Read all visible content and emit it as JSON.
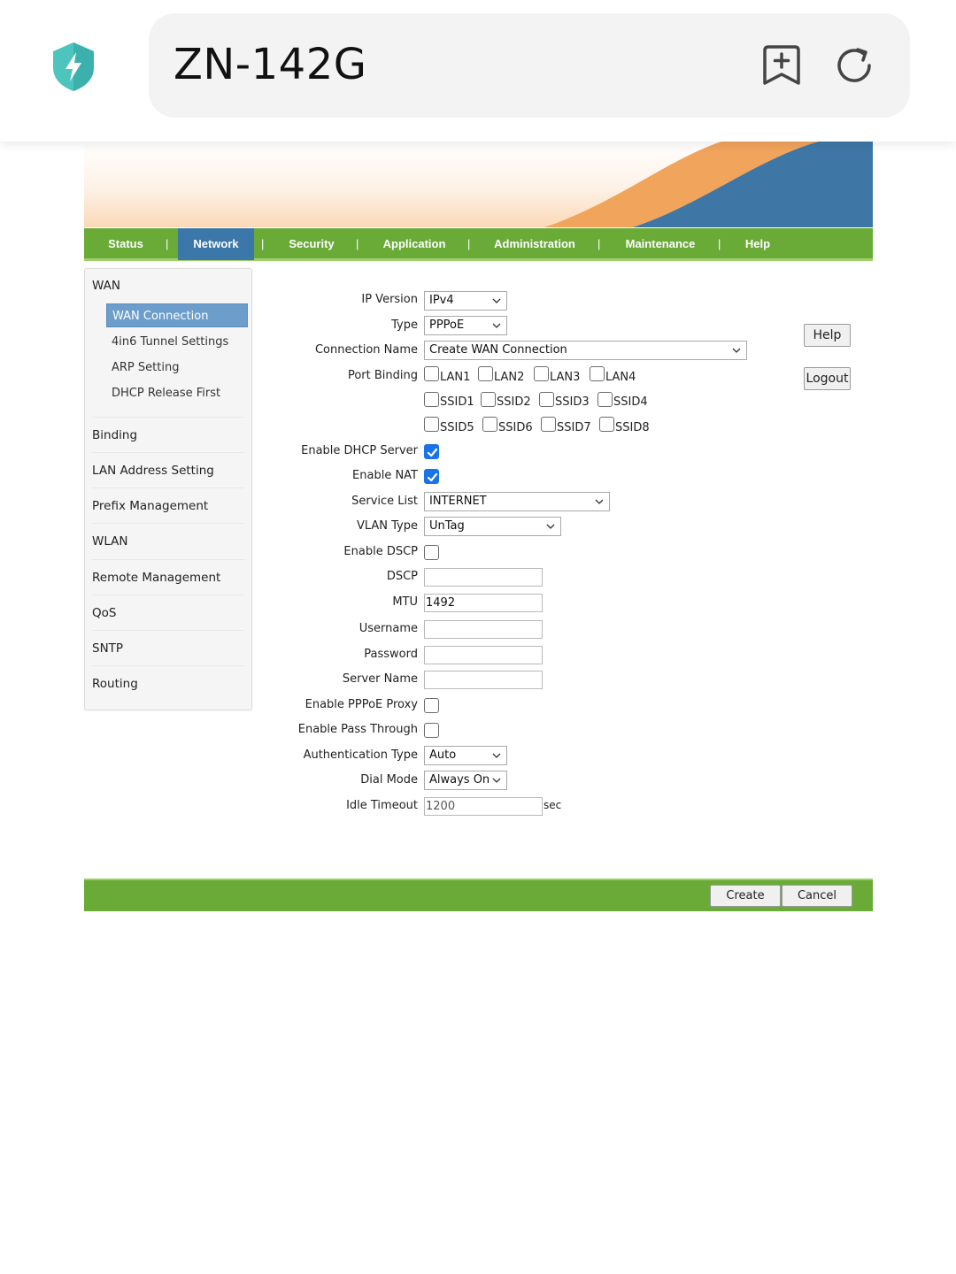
{
  "browser": {
    "url_title": "ZN-142G",
    "shield_icon": "shield-bolt-icon",
    "bookmark_icon": "bookmark-add-icon",
    "reload_icon": "reload-icon"
  },
  "colors": {
    "nav_green": "#6aaa37",
    "nav_active_blue": "#3b77a9",
    "banner_orange": "#f0a45c",
    "banner_blue": "#3e77a6",
    "sidebar_active": "#6d9ecb",
    "checkbox_checked": "#1a73e8"
  },
  "nav": {
    "items": [
      "Status",
      "Network",
      "Security",
      "Application",
      "Administration",
      "Maintenance",
      "Help"
    ],
    "active": "Network",
    "separator": "|"
  },
  "sidebar": {
    "wan": "WAN",
    "wan_items": [
      "WAN Connection",
      "4in6 Tunnel Settings",
      "ARP Setting",
      "DHCP Release First"
    ],
    "active_item": "WAN Connection",
    "sections": [
      "Binding",
      "LAN Address Setting",
      "Prefix Management",
      "WLAN",
      "Remote Management",
      "QoS",
      "SNTP",
      "Routing"
    ]
  },
  "form": {
    "ip_version": {
      "label": "IP Version",
      "value": "IPv4"
    },
    "type": {
      "label": "Type",
      "value": "PPPoE"
    },
    "connection_name": {
      "label": "Connection Name",
      "value": "Create WAN Connection"
    },
    "port_binding": {
      "label": "Port Binding",
      "ports": [
        "LAN1",
        "LAN2",
        "LAN3",
        "LAN4",
        "SSID1",
        "SSID2",
        "SSID3",
        "SSID4",
        "SSID5",
        "SSID6",
        "SSID7",
        "SSID8"
      ],
      "checked": []
    },
    "enable_dhcp_server": {
      "label": "Enable DHCP Server",
      "checked": true
    },
    "enable_nat": {
      "label": "Enable NAT",
      "checked": true
    },
    "service_list": {
      "label": "Service List",
      "value": "INTERNET"
    },
    "vlan_type": {
      "label": "VLAN Type",
      "value": "UnTag"
    },
    "enable_dscp": {
      "label": "Enable DSCP",
      "checked": false
    },
    "dscp": {
      "label": "DSCP",
      "value": ""
    },
    "mtu": {
      "label": "MTU",
      "value": "1492"
    },
    "username": {
      "label": "Username",
      "value": ""
    },
    "password": {
      "label": "Password",
      "value": ""
    },
    "server_name": {
      "label": "Server Name",
      "value": ""
    },
    "enable_pppoe_proxy": {
      "label": "Enable PPPoE Proxy",
      "checked": false
    },
    "enable_pass_through": {
      "label": "Enable Pass Through",
      "checked": false
    },
    "auth_type": {
      "label": "Authentication Type",
      "value": "Auto"
    },
    "dial_mode": {
      "label": "Dial Mode",
      "value": "Always On"
    },
    "idle_timeout": {
      "label": "Idle Timeout",
      "value": "1200",
      "unit": "sec"
    }
  },
  "side_buttons": {
    "help": "Help",
    "logout": "Logout"
  },
  "footer_buttons": {
    "create": "Create",
    "cancel": "Cancel"
  }
}
